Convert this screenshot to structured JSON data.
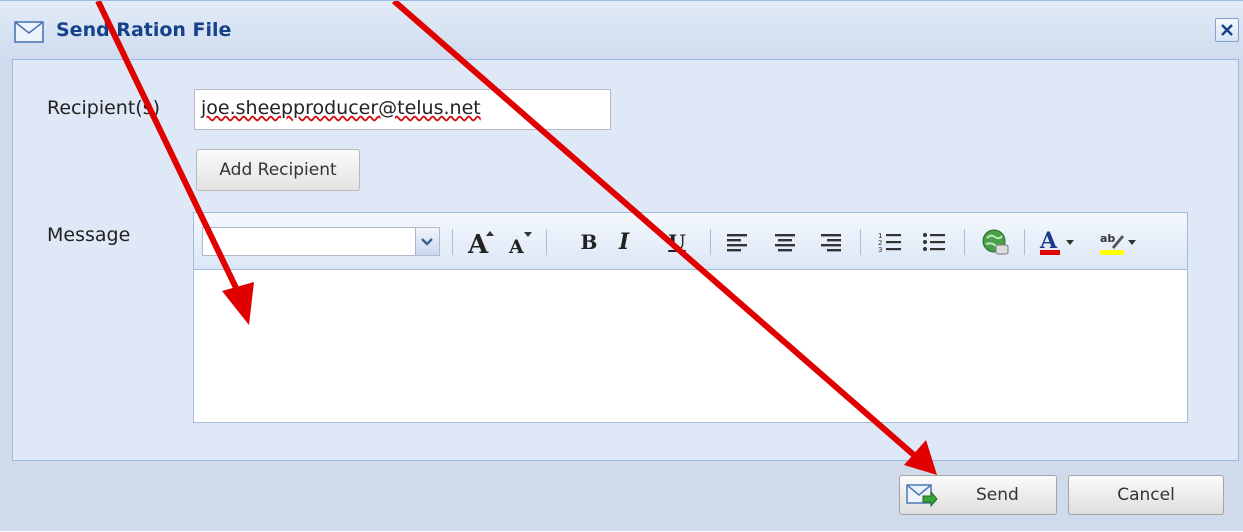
{
  "window": {
    "title": "Send Ration File"
  },
  "form": {
    "recipients_label": "Recipient(s)",
    "recipients_value": "joe.sheepproducer@telus.net",
    "add_recipient_label": "Add Recipient",
    "message_label": "Message",
    "message_value": ""
  },
  "toolbar": {
    "font_value": "",
    "tools": [
      "grow-font-icon",
      "shrink-font-icon",
      "bold-icon",
      "italic-icon",
      "underline-icon",
      "align-left-icon",
      "align-center-icon",
      "align-right-icon",
      "ordered-list-icon",
      "unordered-list-icon",
      "insert-link-icon",
      "font-color-icon",
      "highlight-color-icon"
    ]
  },
  "footer": {
    "send_label": "Send",
    "cancel_label": "Cancel"
  },
  "colors": {
    "title_text": "#15428b",
    "panel_bg": "#dfe8f6",
    "annotation_arrow": "#e00000",
    "font_color_bar": "#e00000",
    "highlight_bar": "#ffff00"
  }
}
